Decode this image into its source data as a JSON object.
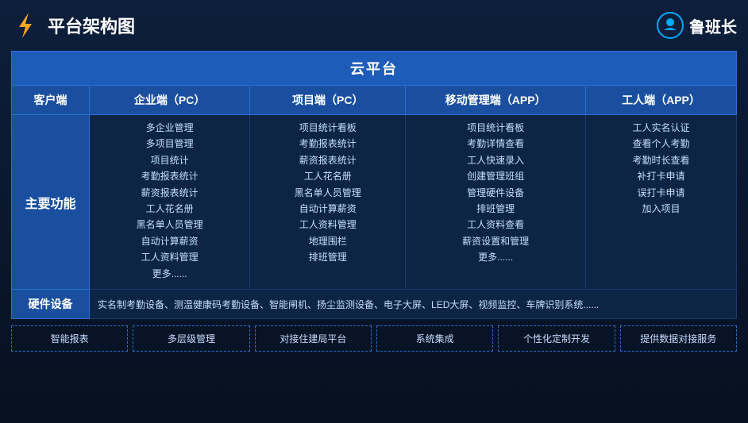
{
  "header": {
    "title": "平台架构图",
    "brand": "鲁班长"
  },
  "table": {
    "cloudPlatform": "云平台",
    "columns": [
      "客户端",
      "企业端（PC）",
      "项目端（PC）",
      "移动管理端（APP）",
      "工人端（APP）"
    ],
    "rows": {
      "mainFunctions": {
        "label": "主要功能",
        "enterprise": [
          "多企业管理",
          "多项目管理",
          "项目统计",
          "考勤报表统计",
          "薪资报表统计",
          "工人花名册",
          "黑名单人员管理",
          "自动计算薪资",
          "工人资料管理",
          "更多......"
        ],
        "project": [
          "项目统计看板",
          "考勤报表统计",
          "薪资报表统计",
          "工人花名册",
          "黑名单人员管理",
          "自动计算薪资",
          "工人资料管理",
          "地理围栏",
          "排班管理",
          "更多......"
        ],
        "mobile": [
          "项目统计看板",
          "考勤详情查看",
          "工人快速录入",
          "创建管理班组",
          "管理硬件设备",
          "排班管理",
          "工人资料查看",
          "薪资设置和管理",
          "更多......"
        ],
        "worker": [
          "工人实名认证",
          "查看个人考勤",
          "考勤时长查看",
          "补打卡申请",
          "误打卡申请",
          "加入项目"
        ]
      },
      "hardware": {
        "label": "硬件设备",
        "content": "实名制考勤设备、测温健康码考勤设备、智能闸机、扬尘监测设备、电子大屏、LED大屏、视频监控、车牌识别系统......"
      }
    }
  },
  "features": [
    "智能报表",
    "多层级管理",
    "对接住建局平台",
    "系统集成",
    "个性化定制开发",
    "提供数据对接服务"
  ]
}
